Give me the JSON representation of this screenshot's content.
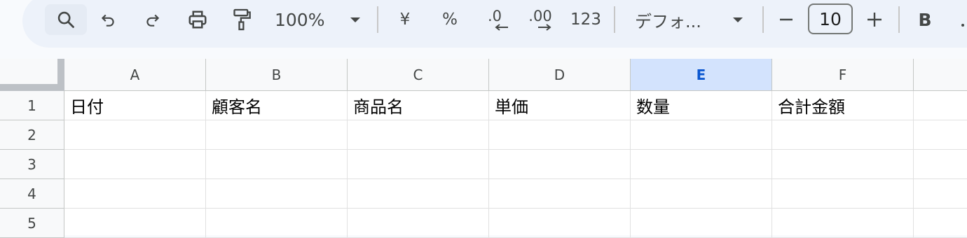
{
  "toolbar": {
    "zoom": "100%",
    "currency_symbol": "¥",
    "percent_symbol": "%",
    "decrease_decimal_label": ".0",
    "increase_decimal_label": ".00",
    "number_format_label": "123",
    "font_name": "デフォ...",
    "font_size": "10",
    "bold_label": "B",
    "icons": {
      "search": "search-icon",
      "undo": "undo-icon",
      "redo": "redo-icon",
      "print": "print-icon",
      "paint_format": "paint-format-icon",
      "zoom_dropdown": "chevron-down-icon",
      "font_dropdown": "chevron-down-icon",
      "decrease_font": "minus-icon",
      "increase_font": "plus-icon"
    }
  },
  "sheet": {
    "columns": [
      "A",
      "B",
      "C",
      "D",
      "E",
      "F"
    ],
    "selected_column": "E",
    "rows": [
      {
        "num": "1",
        "cells": [
          "日付",
          "顧客名",
          "商品名",
          "単価",
          "数量",
          "合計金額"
        ]
      },
      {
        "num": "2",
        "cells": [
          "",
          "",
          "",
          "",
          "",
          ""
        ]
      },
      {
        "num": "3",
        "cells": [
          "",
          "",
          "",
          "",
          "",
          ""
        ]
      },
      {
        "num": "4",
        "cells": [
          "",
          "",
          "",
          "",
          "",
          ""
        ]
      },
      {
        "num": "5",
        "cells": [
          "",
          "",
          "",
          "",
          "",
          ""
        ]
      }
    ]
  },
  "colors": {
    "toolbar_bg": "#edf2fa",
    "selected_column_bg": "#d3e3fd",
    "selected_column_text": "#0b57d0",
    "header_bg": "#f8f9fa"
  }
}
